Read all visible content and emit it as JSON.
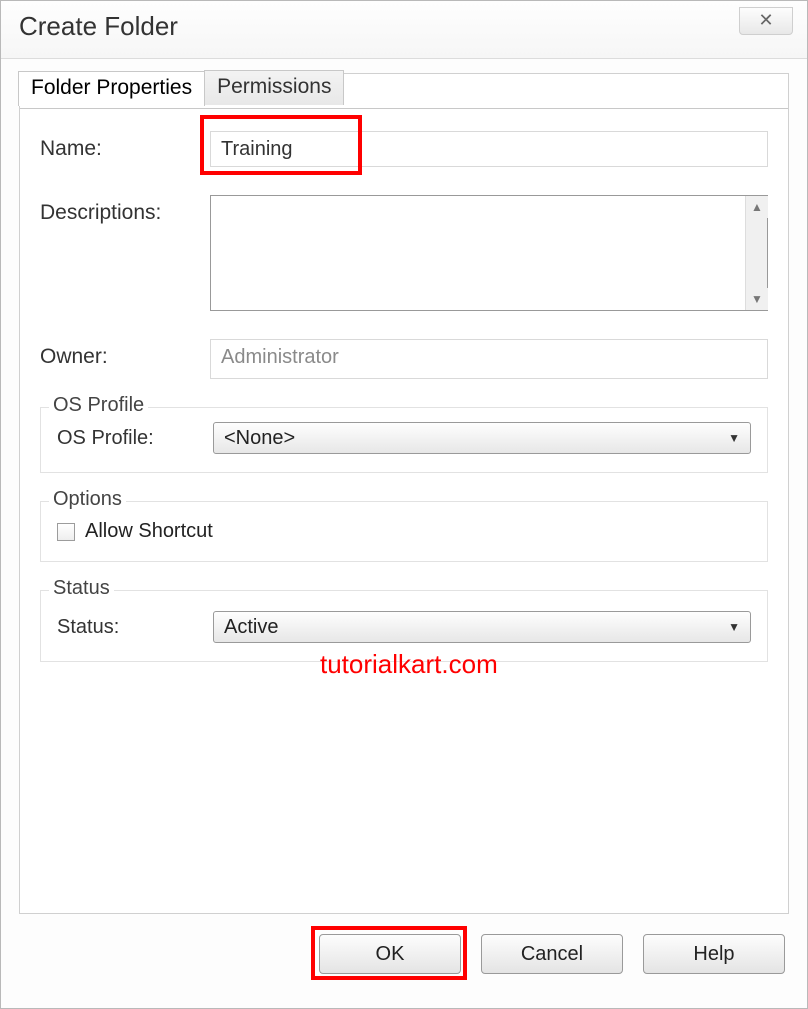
{
  "window": {
    "title": "Create Folder"
  },
  "tabs": [
    {
      "label": "Folder Properties",
      "active": true
    },
    {
      "label": "Permissions",
      "active": false
    }
  ],
  "form": {
    "name_label": "Name:",
    "name_value": "Training",
    "desc_label": "Descriptions:",
    "desc_value": "",
    "owner_label": "Owner:",
    "owner_value": "Administrator"
  },
  "groups": {
    "os_profile": {
      "legend": "OS Profile",
      "label": "OS Profile:",
      "selected": "<None>"
    },
    "options": {
      "legend": "Options",
      "allow_shortcut_label": "Allow Shortcut",
      "allow_shortcut_checked": false
    },
    "status": {
      "legend": "Status",
      "label": "Status:",
      "selected": "Active"
    }
  },
  "buttons": {
    "ok": "OK",
    "cancel": "Cancel",
    "help": "Help"
  },
  "watermark": "tutorialkart.com"
}
